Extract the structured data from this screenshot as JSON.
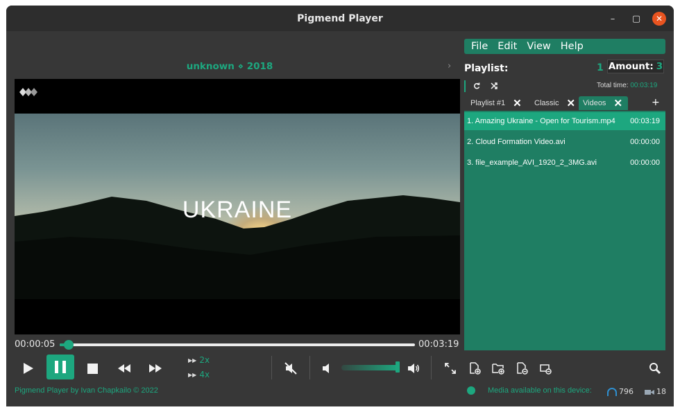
{
  "window": {
    "title": "Pigmend Player",
    "minimize": "–",
    "maximize": "▢",
    "close": "✕"
  },
  "track": {
    "info": "unknown ⋄ 2018",
    "next": "›"
  },
  "video": {
    "text": "UKRAINE"
  },
  "playback": {
    "current_time": "00:00:05",
    "total_time": "00:03:19",
    "progress": 0.025,
    "speed_2x": "2x",
    "speed_4x": "4x",
    "volume": 1.0
  },
  "footer": {
    "credit": "Pigmend Player by Ivan Chapkailo © 2022",
    "media_label": "Media available on this device:",
    "audio_count": "796",
    "video_count": "18"
  },
  "menu": {
    "items": [
      "File",
      "Edit",
      "View",
      "Help"
    ]
  },
  "playlist": {
    "title": "Playlist:",
    "current_index": "1",
    "amount_label": "Amount:",
    "amount_value": "3",
    "total_time_label": "Total time:",
    "total_time_value": "00:03:19",
    "add_tab": "+",
    "tabs": [
      {
        "label": "Playlist #1",
        "active": false
      },
      {
        "label": "Classic",
        "active": false
      },
      {
        "label": "Videos",
        "active": true
      }
    ],
    "items": [
      {
        "name": "1.  Amazing Ukraine - Open for Tourism.mp4",
        "duration": "00:03:19",
        "active": true
      },
      {
        "name": "2.  Cloud Formation Video.avi",
        "duration": "00:00:00",
        "active": false
      },
      {
        "name": "3.  file_example_AVI_1920_2_3MG.avi",
        "duration": "00:00:00",
        "active": false
      }
    ]
  },
  "colors": {
    "accent": "#1da77f",
    "panel": "#1f7e63",
    "background": "#373737"
  }
}
